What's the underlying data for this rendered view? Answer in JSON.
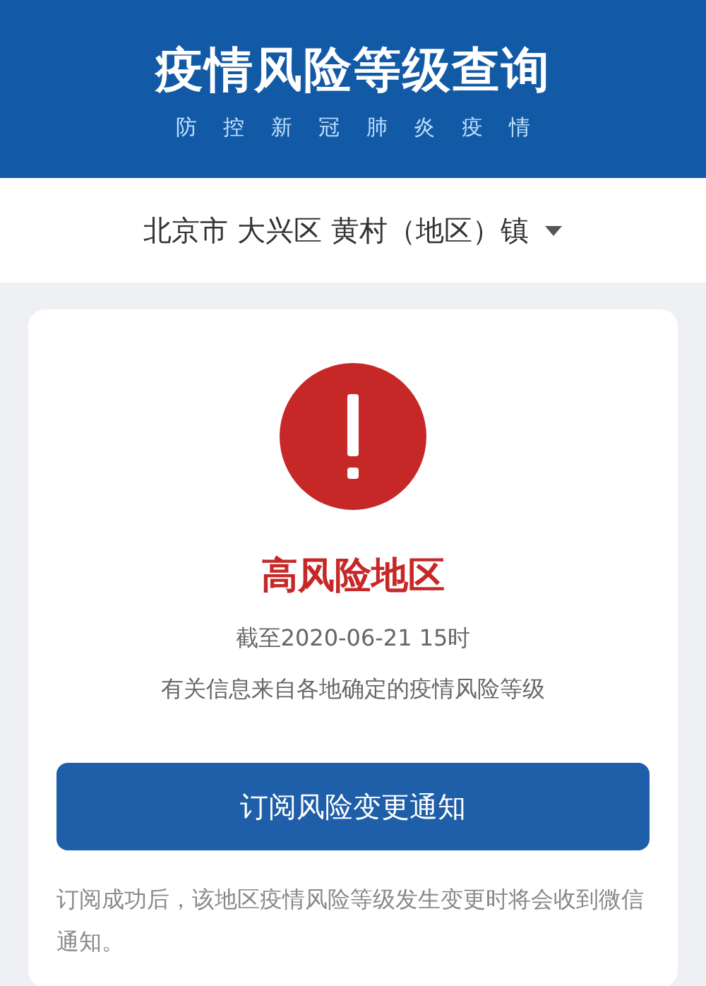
{
  "header": {
    "title": "疫情风险等级查询",
    "subtitle": "防 控 新 冠 肺 炎 疫 情"
  },
  "location": {
    "value": "北京市 大兴区 黄村（地区）镇",
    "expanded": false
  },
  "result": {
    "high_risk": true,
    "risk_label": "高风险地区",
    "as_of": "截至2020-06-21 15时",
    "source": "有关信息来自各地确定的疫情风险等级"
  },
  "subscribe_button": "订阅风险变更通知",
  "note": "订阅成功后，该地区疫情风险等级发生变更时将会收到微信通知。"
}
